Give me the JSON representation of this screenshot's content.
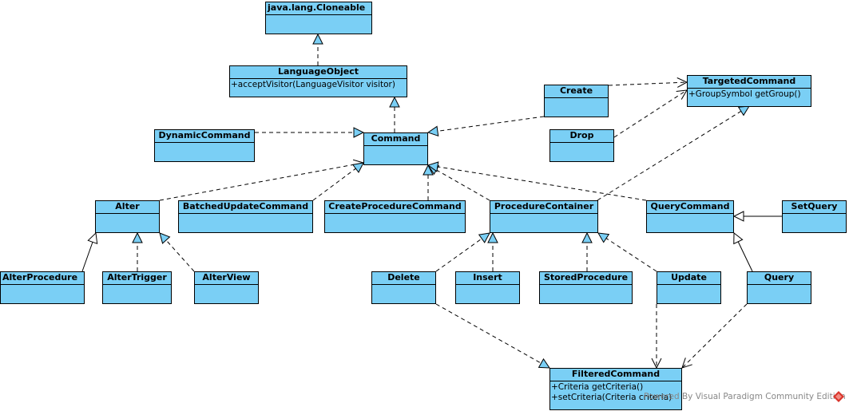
{
  "diagram": {
    "type": "UML class diagram",
    "classes": {
      "cloneable": {
        "name": "java.lang.Cloneable",
        "operations": []
      },
      "languageObject": {
        "name": "LanguageObject",
        "operations": [
          "+acceptVisitor(LanguageVisitor visitor)"
        ]
      },
      "targetedCommand": {
        "name": "TargetedCommand",
        "operations": [
          "+GroupSymbol getGroup()"
        ]
      },
      "create": {
        "name": "Create",
        "operations": []
      },
      "drop": {
        "name": "Drop",
        "operations": []
      },
      "dynamicCommand": {
        "name": "DynamicCommand",
        "operations": []
      },
      "command": {
        "name": "Command",
        "operations": []
      },
      "alter": {
        "name": "Alter",
        "operations": []
      },
      "batchedUpdateCommand": {
        "name": "BatchedUpdateCommand",
        "operations": []
      },
      "createProcedureCommand": {
        "name": "CreateProcedureCommand",
        "operations": []
      },
      "procedureContainer": {
        "name": "ProcedureContainer",
        "operations": []
      },
      "queryCommand": {
        "name": "QueryCommand",
        "operations": []
      },
      "setQuery": {
        "name": "SetQuery",
        "operations": []
      },
      "alterProcedure": {
        "name": "AlterProcedure",
        "operations": []
      },
      "alterTrigger": {
        "name": "AlterTrigger",
        "operations": []
      },
      "alterView": {
        "name": "AlterView",
        "operations": []
      },
      "delete": {
        "name": "Delete",
        "operations": []
      },
      "insert": {
        "name": "Insert",
        "operations": []
      },
      "storedProcedure": {
        "name": "StoredProcedure",
        "operations": []
      },
      "update": {
        "name": "Update",
        "operations": []
      },
      "query": {
        "name": "Query",
        "operations": []
      },
      "filteredCommand": {
        "name": "FilteredCommand",
        "operations": [
          "+Criteria getCriteria()",
          "+setCriteria(Criteria criteria)"
        ]
      }
    },
    "relationships": [
      {
        "from": "languageObject",
        "to": "cloneable",
        "kind": "realization"
      },
      {
        "from": "command",
        "to": "languageObject",
        "kind": "realization"
      },
      {
        "from": "dynamicCommand",
        "to": "command",
        "kind": "realization"
      },
      {
        "from": "create",
        "to": "command",
        "kind": "realization"
      },
      {
        "from": "create",
        "to": "targetedCommand",
        "kind": "dependency"
      },
      {
        "from": "drop",
        "to": "targetedCommand",
        "kind": "dependency"
      },
      {
        "from": "drop",
        "to": "command",
        "kind": "realization"
      },
      {
        "from": "procedureContainer",
        "to": "targetedCommand",
        "kind": "dependency"
      },
      {
        "from": "alter",
        "to": "command",
        "kind": "realization"
      },
      {
        "from": "batchedUpdateCommand",
        "to": "command",
        "kind": "realization"
      },
      {
        "from": "createProcedureCommand",
        "to": "command",
        "kind": "realization"
      },
      {
        "from": "procedureContainer",
        "to": "command",
        "kind": "realization"
      },
      {
        "from": "queryCommand",
        "to": "command",
        "kind": "generalization"
      },
      {
        "from": "setQuery",
        "to": "queryCommand",
        "kind": "generalization"
      },
      {
        "from": "query",
        "to": "queryCommand",
        "kind": "generalization"
      },
      {
        "from": "alterProcedure",
        "to": "alter",
        "kind": "realization"
      },
      {
        "from": "alterTrigger",
        "to": "alter",
        "kind": "realization"
      },
      {
        "from": "alterView",
        "to": "alter",
        "kind": "realization"
      },
      {
        "from": "delete",
        "to": "procedureContainer",
        "kind": "realization"
      },
      {
        "from": "insert",
        "to": "procedureContainer",
        "kind": "realization"
      },
      {
        "from": "storedProcedure",
        "to": "procedureContainer",
        "kind": "realization"
      },
      {
        "from": "update",
        "to": "procedureContainer",
        "kind": "realization"
      },
      {
        "from": "delete",
        "to": "filteredCommand",
        "kind": "dependency"
      },
      {
        "from": "update",
        "to": "filteredCommand",
        "kind": "dependency"
      },
      {
        "from": "query",
        "to": "filteredCommand",
        "kind": "dependency"
      }
    ],
    "colors": {
      "class_fill": "#7acff5",
      "line": "#000000",
      "watermark": "#888888",
      "logo": "#d9342b"
    }
  },
  "watermark": "Powered By Visual Paradigm Community Edition"
}
